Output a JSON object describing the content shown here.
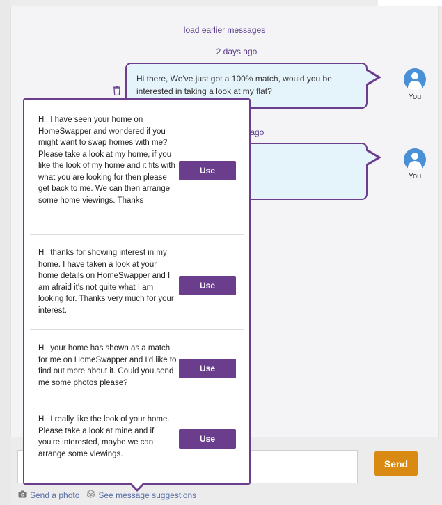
{
  "conversation": {
    "load_earlier": "load earlier messages",
    "groups": [
      {
        "date": "2 days ago",
        "message": "Hi there, We've just got a 100% match, would you be interested in taking a look at my flat?",
        "sender": "You"
      },
      {
        "date": "s ago",
        "message": "",
        "sender": "You"
      }
    ]
  },
  "suggestions": {
    "items": [
      {
        "text": "Hi, I have seen your home on HomeSwapper and wondered if you might want to swap homes with me? Please take a look at my home, if you like the look of my home and it fits with what you are looking for then please get back to me. We can then arrange some home viewings. Thanks",
        "button": "Use"
      },
      {
        "text": "Hi, thanks for showing interest in my home. I have taken a look at your home details on HomeSwapper and I am afraid it's not quite what I am looking for. Thanks very much for your interest.",
        "button": "Use"
      },
      {
        "text": "Hi, your home has shown as a match for me on HomeSwapper and I'd like to find out more about it. Could you send me some photos please?",
        "button": "Use"
      },
      {
        "text": "Hi, I really like the look of your home. Please take a look at mine and if you're interested, maybe we can arrange some viewings.",
        "button": "Use"
      }
    ]
  },
  "composer": {
    "value": "",
    "send_label": "Send",
    "send_photo_label": "Send a photo",
    "suggestions_label": "See message suggestions"
  },
  "colors": {
    "accent": "#6b3d8d",
    "bubble_bg": "#e5f3fb",
    "send": "#d88a12",
    "avatar": "#4a90d6"
  }
}
